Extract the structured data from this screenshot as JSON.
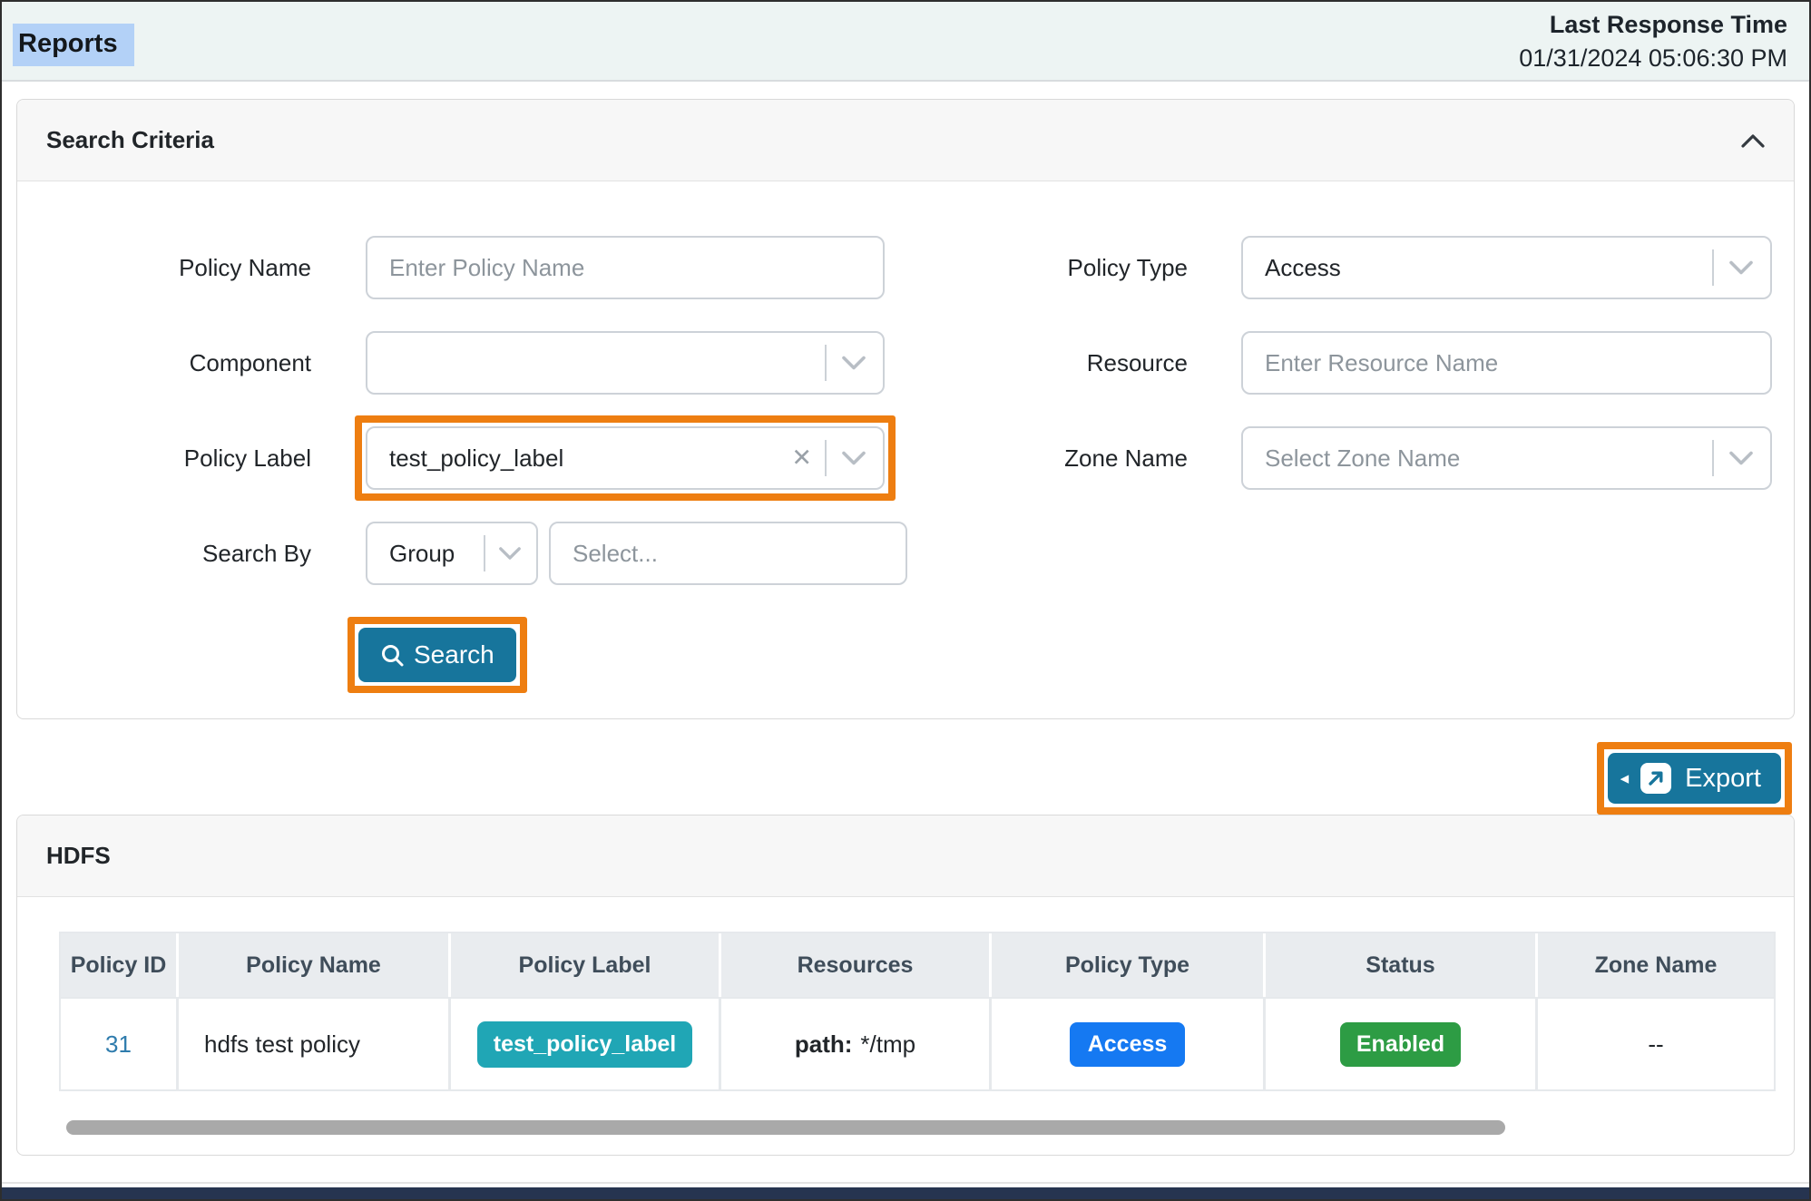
{
  "header": {
    "title": "Reports",
    "last_response_label": "Last Response Time",
    "last_response_value": "01/31/2024 05:06:30 PM"
  },
  "search_criteria": {
    "title": "Search Criteria",
    "policy_name_label": "Policy Name",
    "policy_name_placeholder": "Enter Policy Name",
    "policy_type_label": "Policy Type",
    "policy_type_value": "Access",
    "component_label": "Component",
    "resource_label": "Resource",
    "resource_placeholder": "Enter Resource Name",
    "policy_label_label": "Policy Label",
    "policy_label_value": "test_policy_label",
    "clear_icon": "✕",
    "zone_name_label": "Zone Name",
    "zone_name_placeholder": "Select Zone Name",
    "search_by_label": "Search By",
    "search_by_value": "Group",
    "search_by_placeholder": "Select...",
    "search_button_label": "Search"
  },
  "export_button_label": "Export",
  "hdfs": {
    "title": "HDFS",
    "columns": [
      "Policy ID",
      "Policy Name",
      "Policy Label",
      "Resources",
      "Policy Type",
      "Status",
      "Zone Name"
    ],
    "row": {
      "policy_id": "31",
      "policy_name": "hdfs test policy",
      "policy_label": "test_policy_label",
      "resources_key": "path:",
      "resources_value": "*/tmp",
      "policy_type": "Access",
      "status": "Enabled",
      "zone_name": "--"
    }
  },
  "colors": {
    "button_teal": "#17759c",
    "highlight_orange": "#ee7e11",
    "badge_teal": "#20a6b5",
    "badge_blue": "#1579f2",
    "badge_green": "#2d9c44",
    "title_selection": "#b3d1f7",
    "topbar_bg": "#edf4f3"
  }
}
